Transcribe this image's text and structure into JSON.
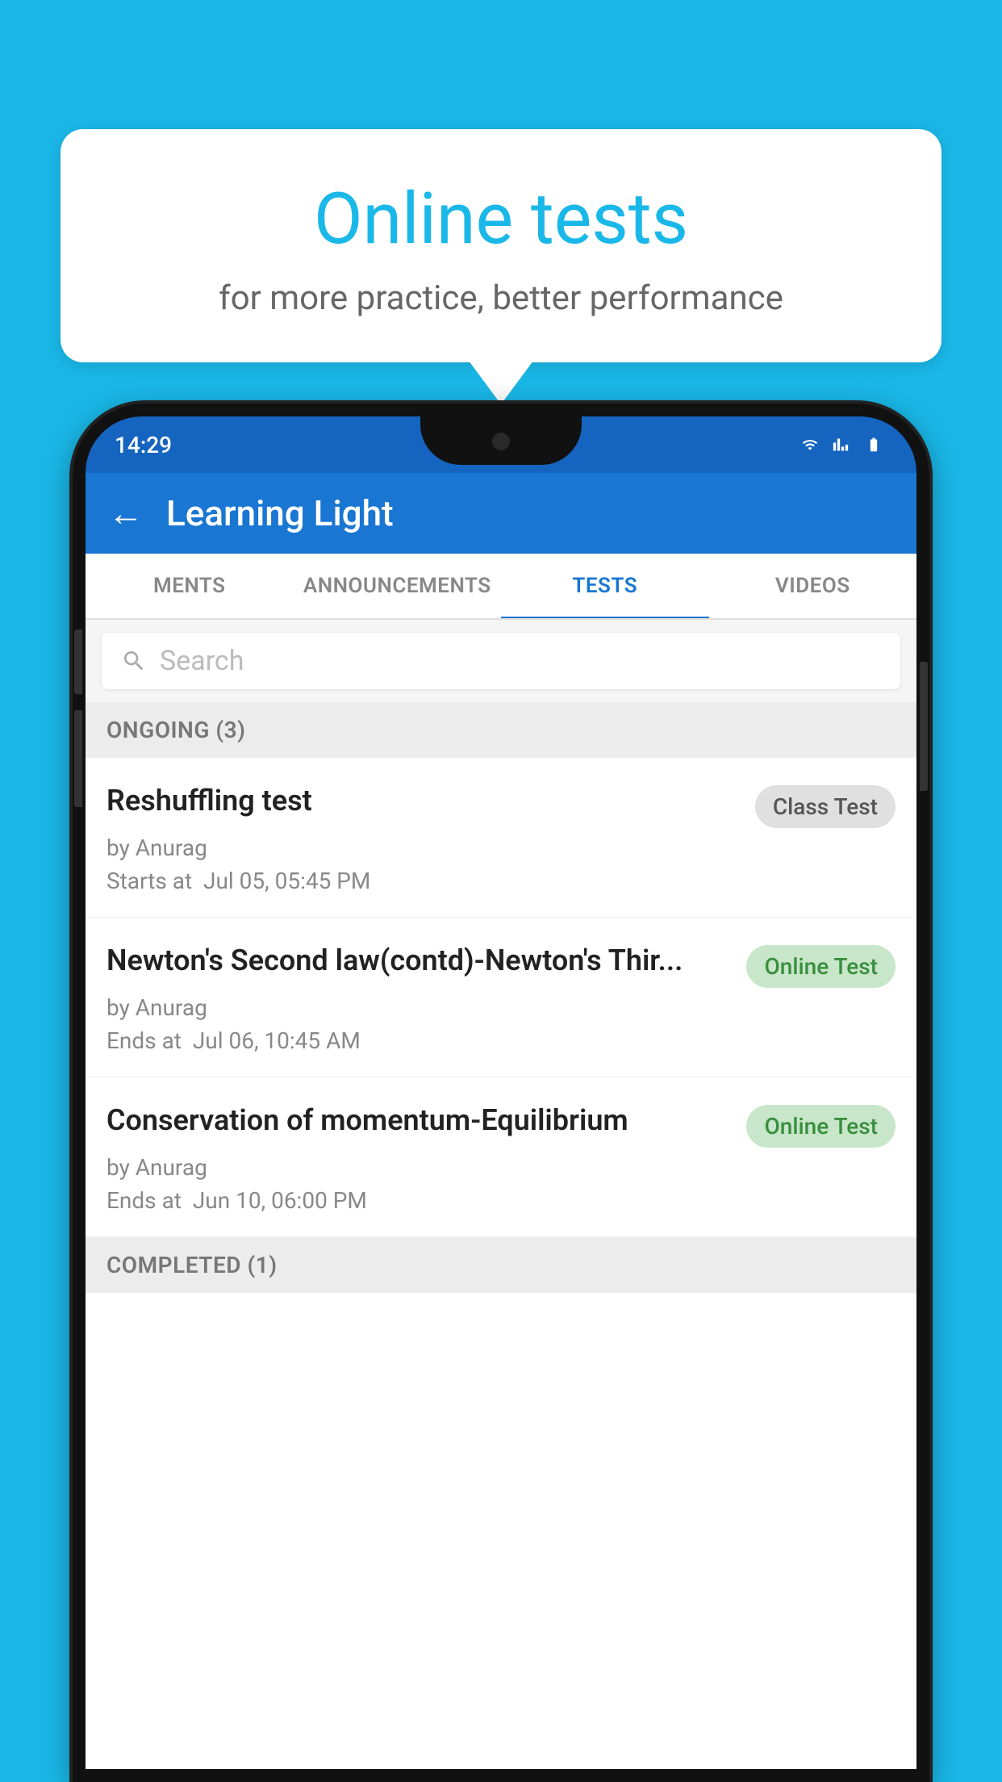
{
  "background_color": "#1ab8e8",
  "bubble": {
    "title": "Online tests",
    "subtitle": "for more practice, better performance"
  },
  "phone": {
    "status_time": "14:29",
    "app_bar": {
      "title": "Learning Light"
    },
    "tabs": [
      {
        "label": "MENTS",
        "active": false
      },
      {
        "label": "ANNOUNCEMENTS",
        "active": false
      },
      {
        "label": "TESTS",
        "active": true
      },
      {
        "label": "VIDEOS",
        "active": false
      }
    ],
    "search": {
      "placeholder": "Search"
    },
    "section_ongoing": "ONGOING (3)",
    "section_completed": "COMPLETED (1)",
    "tests": [
      {
        "title": "Reshuffling test",
        "badge": "Class Test",
        "badge_type": "class",
        "by": "by Anurag",
        "date_label": "Starts at",
        "date": "Jul 05, 05:45 PM"
      },
      {
        "title": "Newton's Second law(contd)-Newton's Thir...",
        "badge": "Online Test",
        "badge_type": "online",
        "by": "by Anurag",
        "date_label": "Ends at",
        "date": "Jul 06, 10:45 AM"
      },
      {
        "title": "Conservation of momentum-Equilibrium",
        "badge": "Online Test",
        "badge_type": "online",
        "by": "by Anurag",
        "date_label": "Ends at",
        "date": "Jun 10, 06:00 PM"
      }
    ]
  }
}
